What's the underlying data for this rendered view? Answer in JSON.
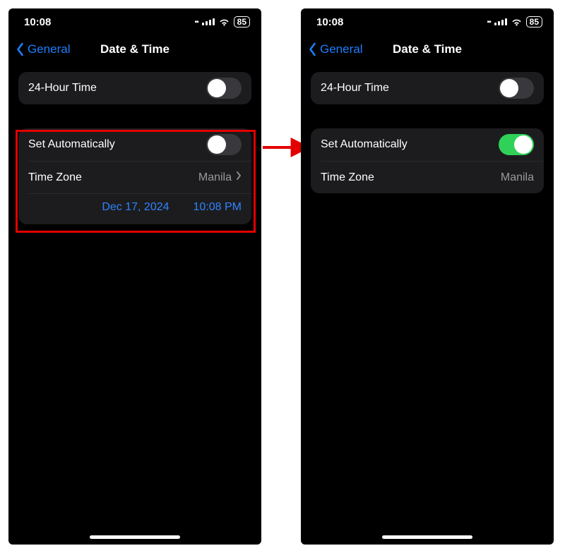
{
  "statusbar": {
    "time": "10:08",
    "battery": "85"
  },
  "nav": {
    "back": "General",
    "title": "Date & Time"
  },
  "rows": {
    "hour24": "24-Hour Time",
    "setauto": "Set Automatically",
    "timezone": "Time Zone",
    "tz_value": "Manila",
    "date": "Dec 17, 2024",
    "time": "10:08 PM"
  },
  "colors": {
    "accent_blue": "#2f83ff",
    "toggle_on": "#30d158",
    "highlight_red": "#e30000"
  }
}
